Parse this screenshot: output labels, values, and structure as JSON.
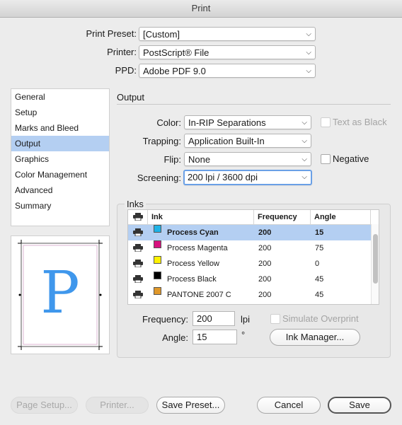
{
  "window": {
    "title": "Print"
  },
  "top": {
    "preset_label": "Print Preset:",
    "preset_value": "[Custom]",
    "printer_label": "Printer:",
    "printer_value": "PostScript® File",
    "ppd_label": "PPD:",
    "ppd_value": "Adobe PDF 9.0"
  },
  "sidebar": {
    "items": [
      {
        "label": "General"
      },
      {
        "label": "Setup"
      },
      {
        "label": "Marks and Bleed"
      },
      {
        "label": "Output"
      },
      {
        "label": "Graphics"
      },
      {
        "label": "Color Management"
      },
      {
        "label": "Advanced"
      },
      {
        "label": "Summary"
      }
    ],
    "active_index": 3
  },
  "preview": {
    "letter": "P"
  },
  "output": {
    "section_title": "Output",
    "color_label": "Color:",
    "color_value": "In-RIP Separations",
    "text_as_black": "Text as Black",
    "trapping_label": "Trapping:",
    "trapping_value": "Application Built-In",
    "flip_label": "Flip:",
    "flip_value": "None",
    "negative": "Negative",
    "screening_label": "Screening:",
    "screening_value": "200 lpi / 3600 dpi"
  },
  "inks": {
    "section_title": "Inks",
    "columns": {
      "ink": "Ink",
      "frequency": "Frequency",
      "angle": "Angle"
    },
    "rows": [
      {
        "name": "Process Cyan",
        "frequency": "200",
        "angle": "15",
        "color": "#1fb2e6",
        "selected": true
      },
      {
        "name": "Process Magenta",
        "frequency": "200",
        "angle": "75",
        "color": "#d6127e",
        "selected": false
      },
      {
        "name": "Process Yellow",
        "frequency": "200",
        "angle": "0",
        "color": "#fff200",
        "selected": false
      },
      {
        "name": "Process Black",
        "frequency": "200",
        "angle": "45",
        "color": "#000000",
        "selected": false
      },
      {
        "name": "PANTONE 2007 C",
        "frequency": "200",
        "angle": "45",
        "color": "#e0982a",
        "selected": false
      }
    ],
    "frequency_label": "Frequency:",
    "frequency_value": "200",
    "frequency_unit": "lpi",
    "angle_label": "Angle:",
    "angle_value": "15",
    "angle_unit": "°",
    "simulate_overprint": "Simulate Overprint",
    "ink_manager": "Ink Manager..."
  },
  "footer": {
    "page_setup": "Page Setup...",
    "printer": "Printer...",
    "save_preset": "Save Preset...",
    "cancel": "Cancel",
    "save": "Save"
  },
  "colors": {
    "accent": "#b4cff2",
    "preview_letter": "#3f97ec"
  }
}
